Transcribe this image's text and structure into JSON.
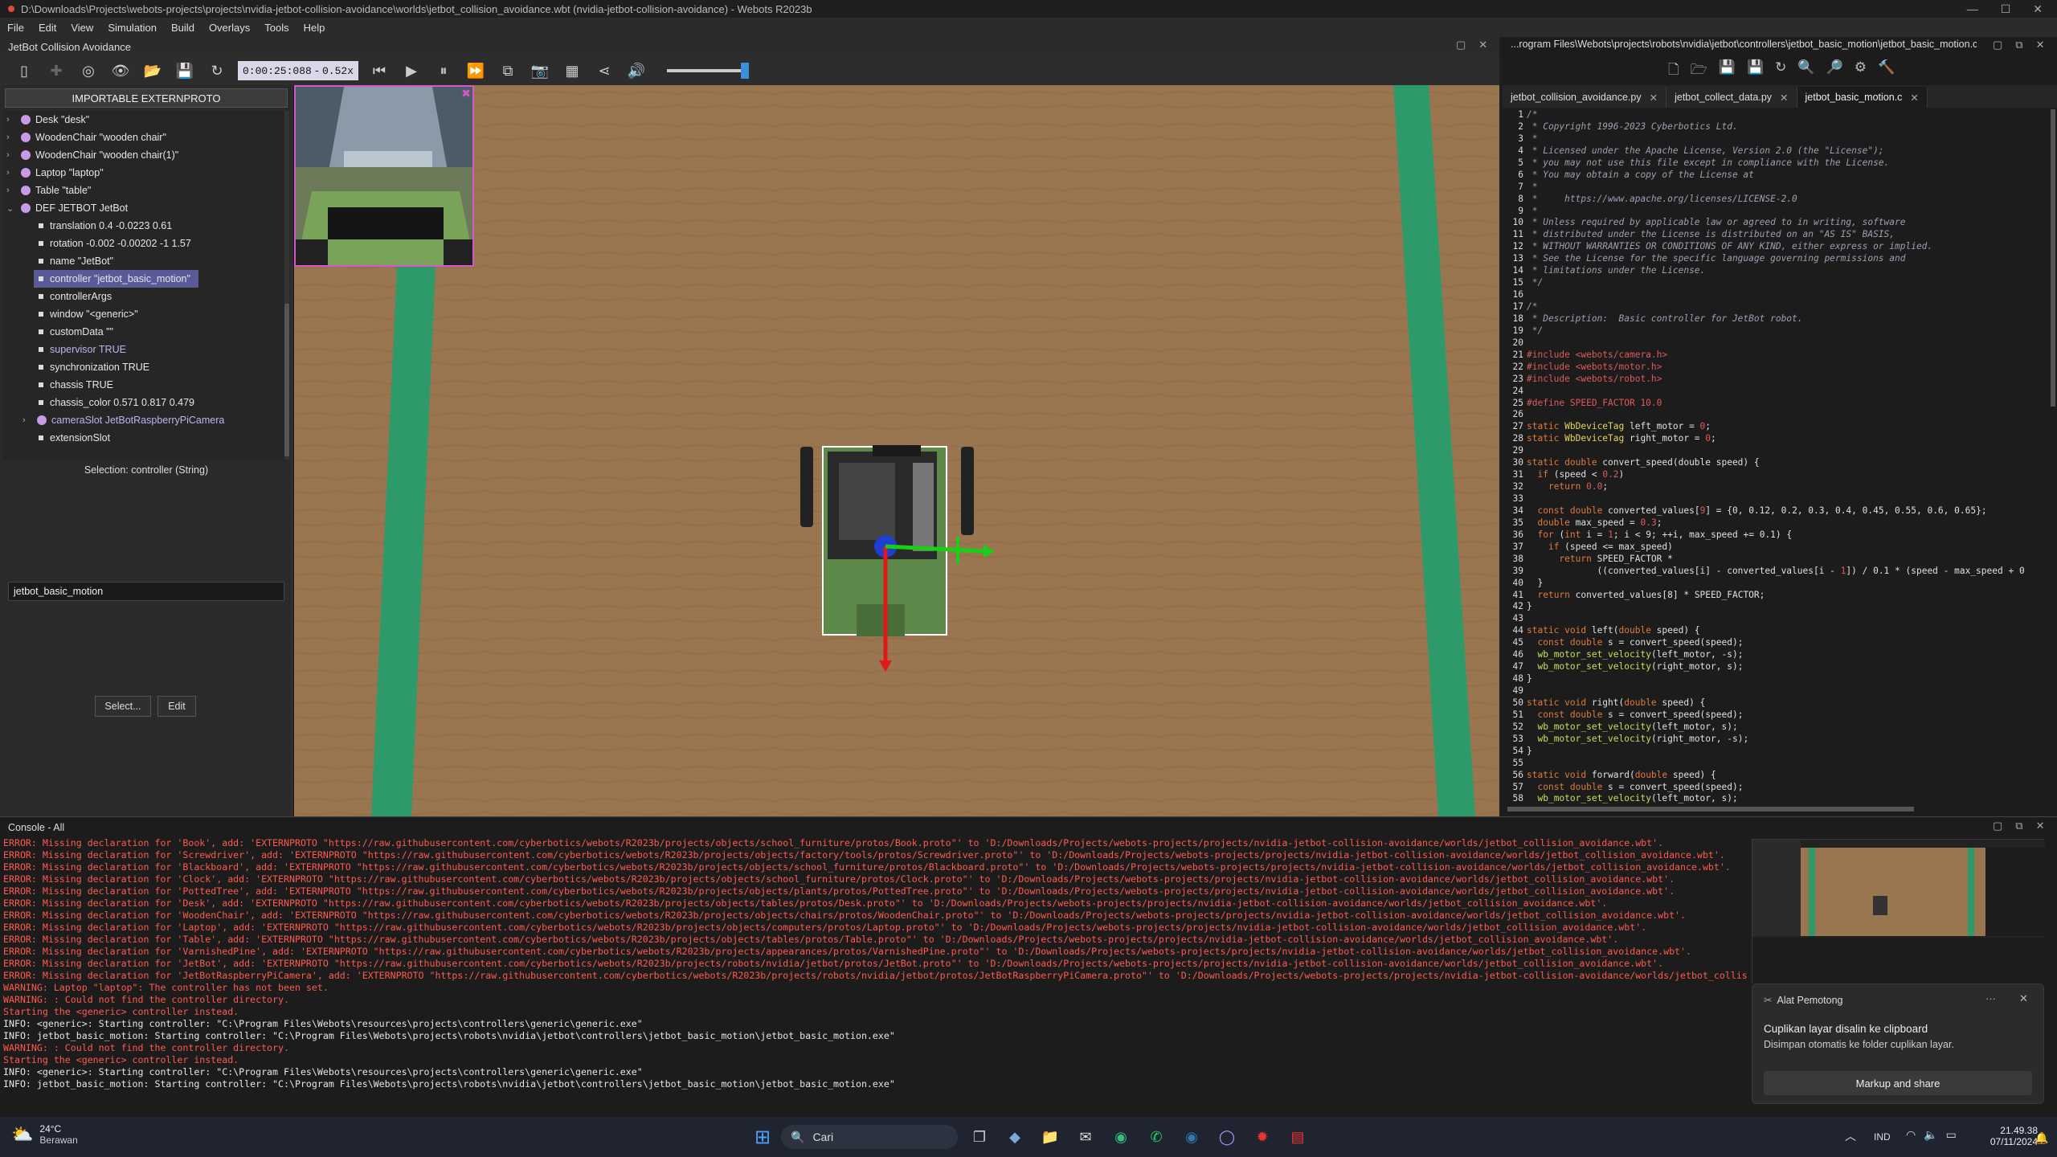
{
  "window": {
    "title": "D:\\Downloads\\Projects\\webots-projects\\projects\\nvidia-jetbot-collision-avoidance\\worlds\\jetbot_collision_avoidance.wbt (nvidia-jetbot-collision-avoidance) - Webots R2023b"
  },
  "menu": [
    "File",
    "Edit",
    "View",
    "Simulation",
    "Build",
    "Overlays",
    "Tools",
    "Help"
  ],
  "document_title": "JetBot Collision Avoidance",
  "toolbar": {
    "time": "0:00:25:088",
    "speed_sep": "-",
    "speed": "0.52x"
  },
  "scene_tree": {
    "header": "IMPORTABLE EXTERNPROTO",
    "nodes": [
      {
        "label": "Desk \"desk\"",
        "type": "node"
      },
      {
        "label": "WoodenChair \"wooden chair\"",
        "type": "node"
      },
      {
        "label": "WoodenChair \"wooden chair(1)\"",
        "type": "node"
      },
      {
        "label": "Laptop \"laptop\"",
        "type": "node"
      },
      {
        "label": "Table \"table\"",
        "type": "node"
      },
      {
        "label": "DEF JETBOT JetBot",
        "type": "node",
        "expanded": true
      },
      {
        "label": "translation 0.4 -0.0223 0.61",
        "type": "field"
      },
      {
        "label": "rotation -0.002 -0.00202 -1 1.57",
        "type": "field"
      },
      {
        "label": "name \"JetBot\"",
        "type": "field"
      },
      {
        "label": "controller \"jetbot_basic_motion\"",
        "type": "field",
        "selected": true
      },
      {
        "label": "controllerArgs",
        "type": "field"
      },
      {
        "label": "window \"<generic>\"",
        "type": "field"
      },
      {
        "label": "customData \"\"",
        "type": "field"
      },
      {
        "label": "supervisor TRUE",
        "type": "field"
      },
      {
        "label": "synchronization TRUE",
        "type": "field"
      },
      {
        "label": "chassis TRUE",
        "type": "field"
      },
      {
        "label": "chassis_color 0.571 0.817 0.479",
        "type": "field"
      },
      {
        "label": "cameraSlot JetBotRaspberryPiCamera",
        "type": "node"
      },
      {
        "label": "extensionSlot",
        "type": "field"
      }
    ],
    "selection": "Selection: controller (String)",
    "value": "jetbot_basic_motion",
    "select_button": "Select...",
    "edit_button": "Edit"
  },
  "editor": {
    "path": "...rogram Files\\Webots\\projects\\robots\\nvidia\\jetbot\\controllers\\jetbot_basic_motion\\jetbot_basic_motion.c",
    "tabs": [
      {
        "label": "jetbot_collision_avoidance.py",
        "active": false
      },
      {
        "label": "jetbot_collect_data.py",
        "active": false
      },
      {
        "label": "jetbot_basic_motion.c",
        "active": true
      }
    ],
    "tab_close": "✕",
    "lines": [
      [
        [
          "cm",
          "/*"
        ]
      ],
      [
        [
          "cm",
          " * Copyright 1996-2023 Cyberbotics Ltd."
        ]
      ],
      [
        [
          "cm",
          " *"
        ]
      ],
      [
        [
          "cm",
          " * Licensed under the Apache License, Version 2.0 (the \"License\");"
        ]
      ],
      [
        [
          "cm",
          " * you may not use this file except in compliance with the License."
        ]
      ],
      [
        [
          "cm",
          " * You may obtain a copy of the License at"
        ]
      ],
      [
        [
          "cm",
          " *"
        ]
      ],
      [
        [
          "cm",
          " *     https://www.apache.org/licenses/LICENSE-2.0"
        ]
      ],
      [
        [
          "cm",
          " *"
        ]
      ],
      [
        [
          "cm",
          " * Unless required by applicable law or agreed to in writing, software"
        ]
      ],
      [
        [
          "cm",
          " * distributed under the License is distributed on an \"AS IS\" BASIS,"
        ]
      ],
      [
        [
          "cm",
          " * WITHOUT WARRANTIES OR CONDITIONS OF ANY KIND, either express or implied."
        ]
      ],
      [
        [
          "cm",
          " * See the License for the specific language governing permissions and"
        ]
      ],
      [
        [
          "cm",
          " * limitations under the License."
        ]
      ],
      [
        [
          "cm",
          " */"
        ]
      ],
      [
        [
          "tx",
          ""
        ]
      ],
      [
        [
          "cm",
          "/*"
        ]
      ],
      [
        [
          "cm",
          " * Description:  Basic controller for JetBot robot."
        ]
      ],
      [
        [
          "cm",
          " */"
        ]
      ],
      [
        [
          "tx",
          ""
        ]
      ],
      [
        [
          "pp",
          "#include <webots/camera.h>"
        ]
      ],
      [
        [
          "pp",
          "#include <webots/motor.h>"
        ]
      ],
      [
        [
          "pp",
          "#include <webots/robot.h>"
        ]
      ],
      [
        [
          "tx",
          ""
        ]
      ],
      [
        [
          "pp",
          "#define SPEED_FACTOR 10.0"
        ]
      ],
      [
        [
          "tx",
          ""
        ]
      ],
      [
        [
          "kw",
          "static "
        ],
        [
          "ty",
          "WbDeviceTag"
        ],
        [
          "tx",
          " left_motor = "
        ],
        [
          "nm",
          "0"
        ],
        [
          "tx",
          ";"
        ]
      ],
      [
        [
          "kw",
          "static "
        ],
        [
          "ty",
          "WbDeviceTag"
        ],
        [
          "tx",
          " right_motor = "
        ],
        [
          "nm",
          "0"
        ],
        [
          "tx",
          ";"
        ]
      ],
      [
        [
          "tx",
          ""
        ]
      ],
      [
        [
          "kw",
          "static double "
        ],
        [
          "tx",
          "convert_speed(double speed) {"
        ]
      ],
      [
        [
          "tx",
          "  "
        ],
        [
          "kw",
          "if"
        ],
        [
          "tx",
          " (speed < "
        ],
        [
          "nm",
          "0.2"
        ],
        [
          "tx",
          ")"
        ]
      ],
      [
        [
          "tx",
          "    "
        ],
        [
          "kw",
          "return "
        ],
        [
          "nm",
          "0.0"
        ],
        [
          "tx",
          ";"
        ]
      ],
      [
        [
          "tx",
          ""
        ]
      ],
      [
        [
          "tx",
          "  "
        ],
        [
          "kw",
          "const double "
        ],
        [
          "tx",
          "converted_values["
        ],
        [
          "nm",
          "9"
        ],
        [
          "tx",
          "] = {0, 0.12, 0.2, 0.3, 0.4, 0.45, 0.55, 0.6, 0.65};"
        ]
      ],
      [
        [
          "tx",
          "  "
        ],
        [
          "kw",
          "double "
        ],
        [
          "tx",
          "max_speed = "
        ],
        [
          "nm",
          "0.3"
        ],
        [
          "tx",
          ";"
        ]
      ],
      [
        [
          "tx",
          "  "
        ],
        [
          "kw",
          "for"
        ],
        [
          "tx",
          " ("
        ],
        [
          "kw",
          "int "
        ],
        [
          "tx",
          "i = "
        ],
        [
          "nm",
          "1"
        ],
        [
          "tx",
          "; i < 9; ++i, max_speed += 0.1) {"
        ]
      ],
      [
        [
          "tx",
          "    "
        ],
        [
          "kw",
          "if"
        ],
        [
          "tx",
          " (speed <= max_speed)"
        ]
      ],
      [
        [
          "tx",
          "      "
        ],
        [
          "kw",
          "return "
        ],
        [
          "tx",
          "SPEED_FACTOR *"
        ]
      ],
      [
        [
          "tx",
          "             ((converted_values[i] - converted_values[i - "
        ],
        [
          "nm",
          "1"
        ],
        [
          "tx",
          "]) / 0.1 * (speed - max_speed + 0"
        ]
      ],
      [
        [
          "tx",
          "  }"
        ]
      ],
      [
        [
          "tx",
          "  "
        ],
        [
          "kw",
          "return "
        ],
        [
          "tx",
          "converted_values[8] * SPEED_FACTOR;"
        ]
      ],
      [
        [
          "tx",
          "}"
        ]
      ],
      [
        [
          "tx",
          ""
        ]
      ],
      [
        [
          "kw",
          "static void "
        ],
        [
          "tx",
          "left("
        ],
        [
          "kw",
          "double"
        ],
        [
          "tx",
          " speed) {"
        ]
      ],
      [
        [
          "tx",
          "  "
        ],
        [
          "kw",
          "const double "
        ],
        [
          "tx",
          "s = convert_speed(speed);"
        ]
      ],
      [
        [
          "tx",
          "  "
        ],
        [
          "fn",
          "wb_motor_set_velocity"
        ],
        [
          "tx",
          "(left_motor, -s);"
        ]
      ],
      [
        [
          "tx",
          "  "
        ],
        [
          "fn",
          "wb_motor_set_velocity"
        ],
        [
          "tx",
          "(right_motor, s);"
        ]
      ],
      [
        [
          "tx",
          "}"
        ]
      ],
      [
        [
          "tx",
          ""
        ]
      ],
      [
        [
          "kw",
          "static void "
        ],
        [
          "tx",
          "right("
        ],
        [
          "kw",
          "double"
        ],
        [
          "tx",
          " speed) {"
        ]
      ],
      [
        [
          "tx",
          "  "
        ],
        [
          "kw",
          "const double "
        ],
        [
          "tx",
          "s = convert_speed(speed);"
        ]
      ],
      [
        [
          "tx",
          "  "
        ],
        [
          "fn",
          "wb_motor_set_velocity"
        ],
        [
          "tx",
          "(left_motor, s);"
        ]
      ],
      [
        [
          "tx",
          "  "
        ],
        [
          "fn",
          "wb_motor_set_velocity"
        ],
        [
          "tx",
          "(right_motor, -s);"
        ]
      ],
      [
        [
          "tx",
          "}"
        ]
      ],
      [
        [
          "tx",
          ""
        ]
      ],
      [
        [
          "kw",
          "static void "
        ],
        [
          "tx",
          "forward("
        ],
        [
          "kw",
          "double"
        ],
        [
          "tx",
          " speed) {"
        ]
      ],
      [
        [
          "tx",
          "  "
        ],
        [
          "kw",
          "const double "
        ],
        [
          "tx",
          "s = convert_speed(speed);"
        ]
      ],
      [
        [
          "tx",
          "  "
        ],
        [
          "fn",
          "wb_motor_set_velocity"
        ],
        [
          "tx",
          "(left_motor, s);"
        ]
      ]
    ]
  },
  "console": {
    "title": "Console - All",
    "lines": [
      [
        "err",
        "ERROR: Missing declaration for 'Book', add: 'EXTERNPROTO \"https://raw.githubusercontent.com/cyberbotics/webots/R2023b/projects/objects/school_furniture/protos/Book.proto\"' to 'D:/Downloads/Projects/webots-projects/projects/nvidia-jetbot-collision-avoidance/worlds/jetbot_collision_avoidance.wbt'."
      ],
      [
        "err",
        "ERROR: Missing declaration for 'Screwdriver', add: 'EXTERNPROTO \"https://raw.githubusercontent.com/cyberbotics/webots/R2023b/projects/objects/factory/tools/protos/Screwdriver.proto\"' to 'D:/Downloads/Projects/webots-projects/projects/nvidia-jetbot-collision-avoidance/worlds/jetbot_collision_avoidance.wbt'."
      ],
      [
        "err",
        "ERROR: Missing declaration for 'Blackboard', add: 'EXTERNPROTO \"https://raw.githubusercontent.com/cyberbotics/webots/R2023b/projects/objects/school_furniture/protos/Blackboard.proto\"' to 'D:/Downloads/Projects/webots-projects/projects/nvidia-jetbot-collision-avoidance/worlds/jetbot_collision_avoidance.wbt'."
      ],
      [
        "err",
        "ERROR: Missing declaration for 'Clock', add: 'EXTERNPROTO \"https://raw.githubusercontent.com/cyberbotics/webots/R2023b/projects/objects/school_furniture/protos/Clock.proto\"' to 'D:/Downloads/Projects/webots-projects/projects/nvidia-jetbot-collision-avoidance/worlds/jetbot_collision_avoidance.wbt'."
      ],
      [
        "err",
        "ERROR: Missing declaration for 'PottedTree', add: 'EXTERNPROTO \"https://raw.githubusercontent.com/cyberbotics/webots/R2023b/projects/objects/plants/protos/PottedTree.proto\"' to 'D:/Downloads/Projects/webots-projects/projects/nvidia-jetbot-collision-avoidance/worlds/jetbot_collision_avoidance.wbt'."
      ],
      [
        "err",
        "ERROR: Missing declaration for 'Desk', add: 'EXTERNPROTO \"https://raw.githubusercontent.com/cyberbotics/webots/R2023b/projects/objects/tables/protos/Desk.proto\"' to 'D:/Downloads/Projects/webots-projects/projects/nvidia-jetbot-collision-avoidance/worlds/jetbot_collision_avoidance.wbt'."
      ],
      [
        "err",
        "ERROR: Missing declaration for 'WoodenChair', add: 'EXTERNPROTO \"https://raw.githubusercontent.com/cyberbotics/webots/R2023b/projects/objects/chairs/protos/WoodenChair.proto\"' to 'D:/Downloads/Projects/webots-projects/projects/nvidia-jetbot-collision-avoidance/worlds/jetbot_collision_avoidance.wbt'."
      ],
      [
        "err",
        "ERROR: Missing declaration for 'Laptop', add: 'EXTERNPROTO \"https://raw.githubusercontent.com/cyberbotics/webots/R2023b/projects/objects/computers/protos/Laptop.proto\"' to 'D:/Downloads/Projects/webots-projects/projects/nvidia-jetbot-collision-avoidance/worlds/jetbot_collision_avoidance.wbt'."
      ],
      [
        "err",
        "ERROR: Missing declaration for 'Table', add: 'EXTERNPROTO \"https://raw.githubusercontent.com/cyberbotics/webots/R2023b/projects/objects/tables/protos/Table.proto\"' to 'D:/Downloads/Projects/webots-projects/projects/nvidia-jetbot-collision-avoidance/worlds/jetbot_collision_avoidance.wbt'."
      ],
      [
        "err",
        "ERROR: Missing declaration for 'VarnishedPine', add: 'EXTERNPROTO \"https://raw.githubusercontent.com/cyberbotics/webots/R2023b/projects/appearances/protos/VarnishedPine.proto\"' to 'D:/Downloads/Projects/webots-projects/projects/nvidia-jetbot-collision-avoidance/worlds/jetbot_collision_avoidance.wbt'."
      ],
      [
        "err",
        "ERROR: Missing declaration for 'JetBot', add: 'EXTERNPROTO \"https://raw.githubusercontent.com/cyberbotics/webots/R2023b/projects/robots/nvidia/jetbot/protos/JetBot.proto\"' to 'D:/Downloads/Projects/webots-projects/projects/nvidia-jetbot-collision-avoidance/worlds/jetbot_collision_avoidance.wbt'."
      ],
      [
        "err",
        "ERROR: Missing declaration for 'JetBotRaspberryPiCamera', add: 'EXTERNPROTO \"https://raw.githubusercontent.com/cyberbotics/webots/R2023b/projects/robots/nvidia/jetbot/protos/JetBotRaspberryPiCamera.proto\"' to 'D:/Downloads/Projects/webots-projects/projects/nvidia-jetbot-collision-avoidance/worlds/jetbot_collis"
      ],
      [
        "warn",
        "WARNING: Laptop \"laptop\": The controller has not been set."
      ],
      [
        "warn",
        "WARNING: : Could not find the controller directory."
      ],
      [
        "warn",
        "Starting the <generic> controller instead."
      ],
      [
        "info",
        "INFO: <generic>: Starting controller: \"C:\\Program Files\\Webots\\resources\\projects\\controllers\\generic\\generic.exe\""
      ],
      [
        "info",
        "INFO: jetbot_basic_motion: Starting controller: \"C:\\Program Files\\Webots\\projects\\robots\\nvidia\\jetbot\\controllers\\jetbot_basic_motion\\jetbot_basic_motion.exe\""
      ],
      [
        "warn",
        "WARNING: : Could not find the controller directory."
      ],
      [
        "warn",
        "Starting the <generic> controller instead."
      ],
      [
        "info",
        "INFO: <generic>: Starting controller: \"C:\\Program Files\\Webots\\resources\\projects\\controllers\\generic\\generic.exe\""
      ],
      [
        "info",
        "INFO: jetbot_basic_motion: Starting controller: \"C:\\Program Files\\Webots\\projects\\robots\\nvidia\\jetbot\\controllers\\jetbot_basic_motion\\jetbot_basic_motion.exe\""
      ]
    ]
  },
  "notification": {
    "app": "Alat Pemotong",
    "menu": "···",
    "close": "✕",
    "title": "Cuplikan layar disalin ke clipboard",
    "body": "Disimpan otomatis ke folder cuplikan layar.",
    "button": "Markup and share"
  },
  "taskbar": {
    "weather_temp": "24°C",
    "weather_desc": "Berawan",
    "search": "Cari",
    "language": "IND",
    "time": "21.49.38",
    "date": "07/11/2024"
  },
  "colors": {
    "selection": "#5a5a98",
    "error": "#ff5a4e",
    "floor": "#9a7650",
    "stripe": "#2e9a6a",
    "overlay_border": "#d657c8"
  }
}
